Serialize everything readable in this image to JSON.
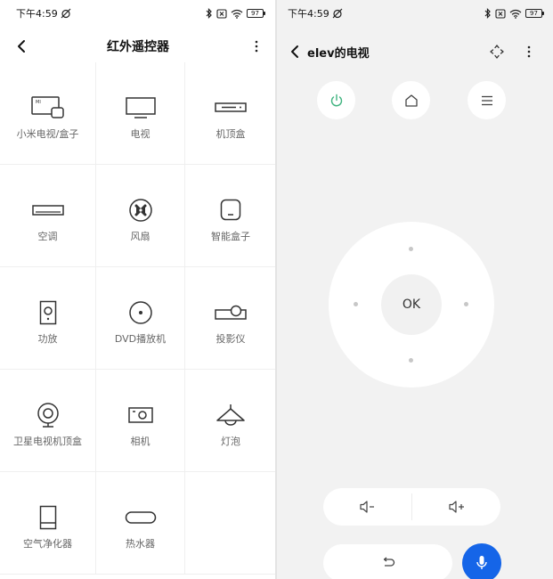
{
  "colors": {
    "accent_green": "#3fb37f",
    "mic_blue": "#1565e8",
    "panel_bg": "#f2f2f2"
  },
  "left_screen": {
    "status_bar": {
      "time": "下午4:59",
      "battery": "97"
    },
    "header": {
      "title": "红外遥控器",
      "back_icon": "back-arrow-icon",
      "menu_icon": "more-vert-icon"
    },
    "devices": [
      {
        "label": "小米电视/盒子",
        "icon": "mi-tv-box-icon"
      },
      {
        "label": "电视",
        "icon": "tv-icon"
      },
      {
        "label": "机顶盒",
        "icon": "set-top-box-icon"
      },
      {
        "label": "空调",
        "icon": "air-conditioner-icon"
      },
      {
        "label": "风扇",
        "icon": "fan-icon"
      },
      {
        "label": "智能盒子",
        "icon": "smart-box-icon"
      },
      {
        "label": "功放",
        "icon": "amplifier-icon"
      },
      {
        "label": "DVD播放机",
        "icon": "dvd-player-icon"
      },
      {
        "label": "投影仪",
        "icon": "projector-icon"
      },
      {
        "label": "卫星电视机顶盒",
        "icon": "satellite-box-icon"
      },
      {
        "label": "相机",
        "icon": "camera-icon"
      },
      {
        "label": "灯泡",
        "icon": "light-bulb-icon"
      },
      {
        "label": "空气净化器",
        "icon": "air-purifier-icon"
      },
      {
        "label": "热水器",
        "icon": "water-heater-icon"
      }
    ]
  },
  "right_screen": {
    "status_bar": {
      "time": "下午4:59",
      "battery": "97"
    },
    "header": {
      "title": "elev的电视",
      "back_icon": "back-arrow-icon",
      "move_icon": "move-arrows-icon",
      "menu_icon": "more-vert-icon"
    },
    "top_buttons": [
      {
        "name": "power",
        "icon": "power-icon"
      },
      {
        "name": "home",
        "icon": "home-icon"
      },
      {
        "name": "menu",
        "icon": "hamburger-menu-icon"
      }
    ],
    "dpad": {
      "ok_label": "OK"
    },
    "volume": {
      "down_icon": "volume-down-icon",
      "up_icon": "volume-up-icon"
    },
    "back_button": {
      "icon": "return-arrow-icon"
    },
    "voice_button": {
      "icon": "microphone-icon"
    }
  }
}
